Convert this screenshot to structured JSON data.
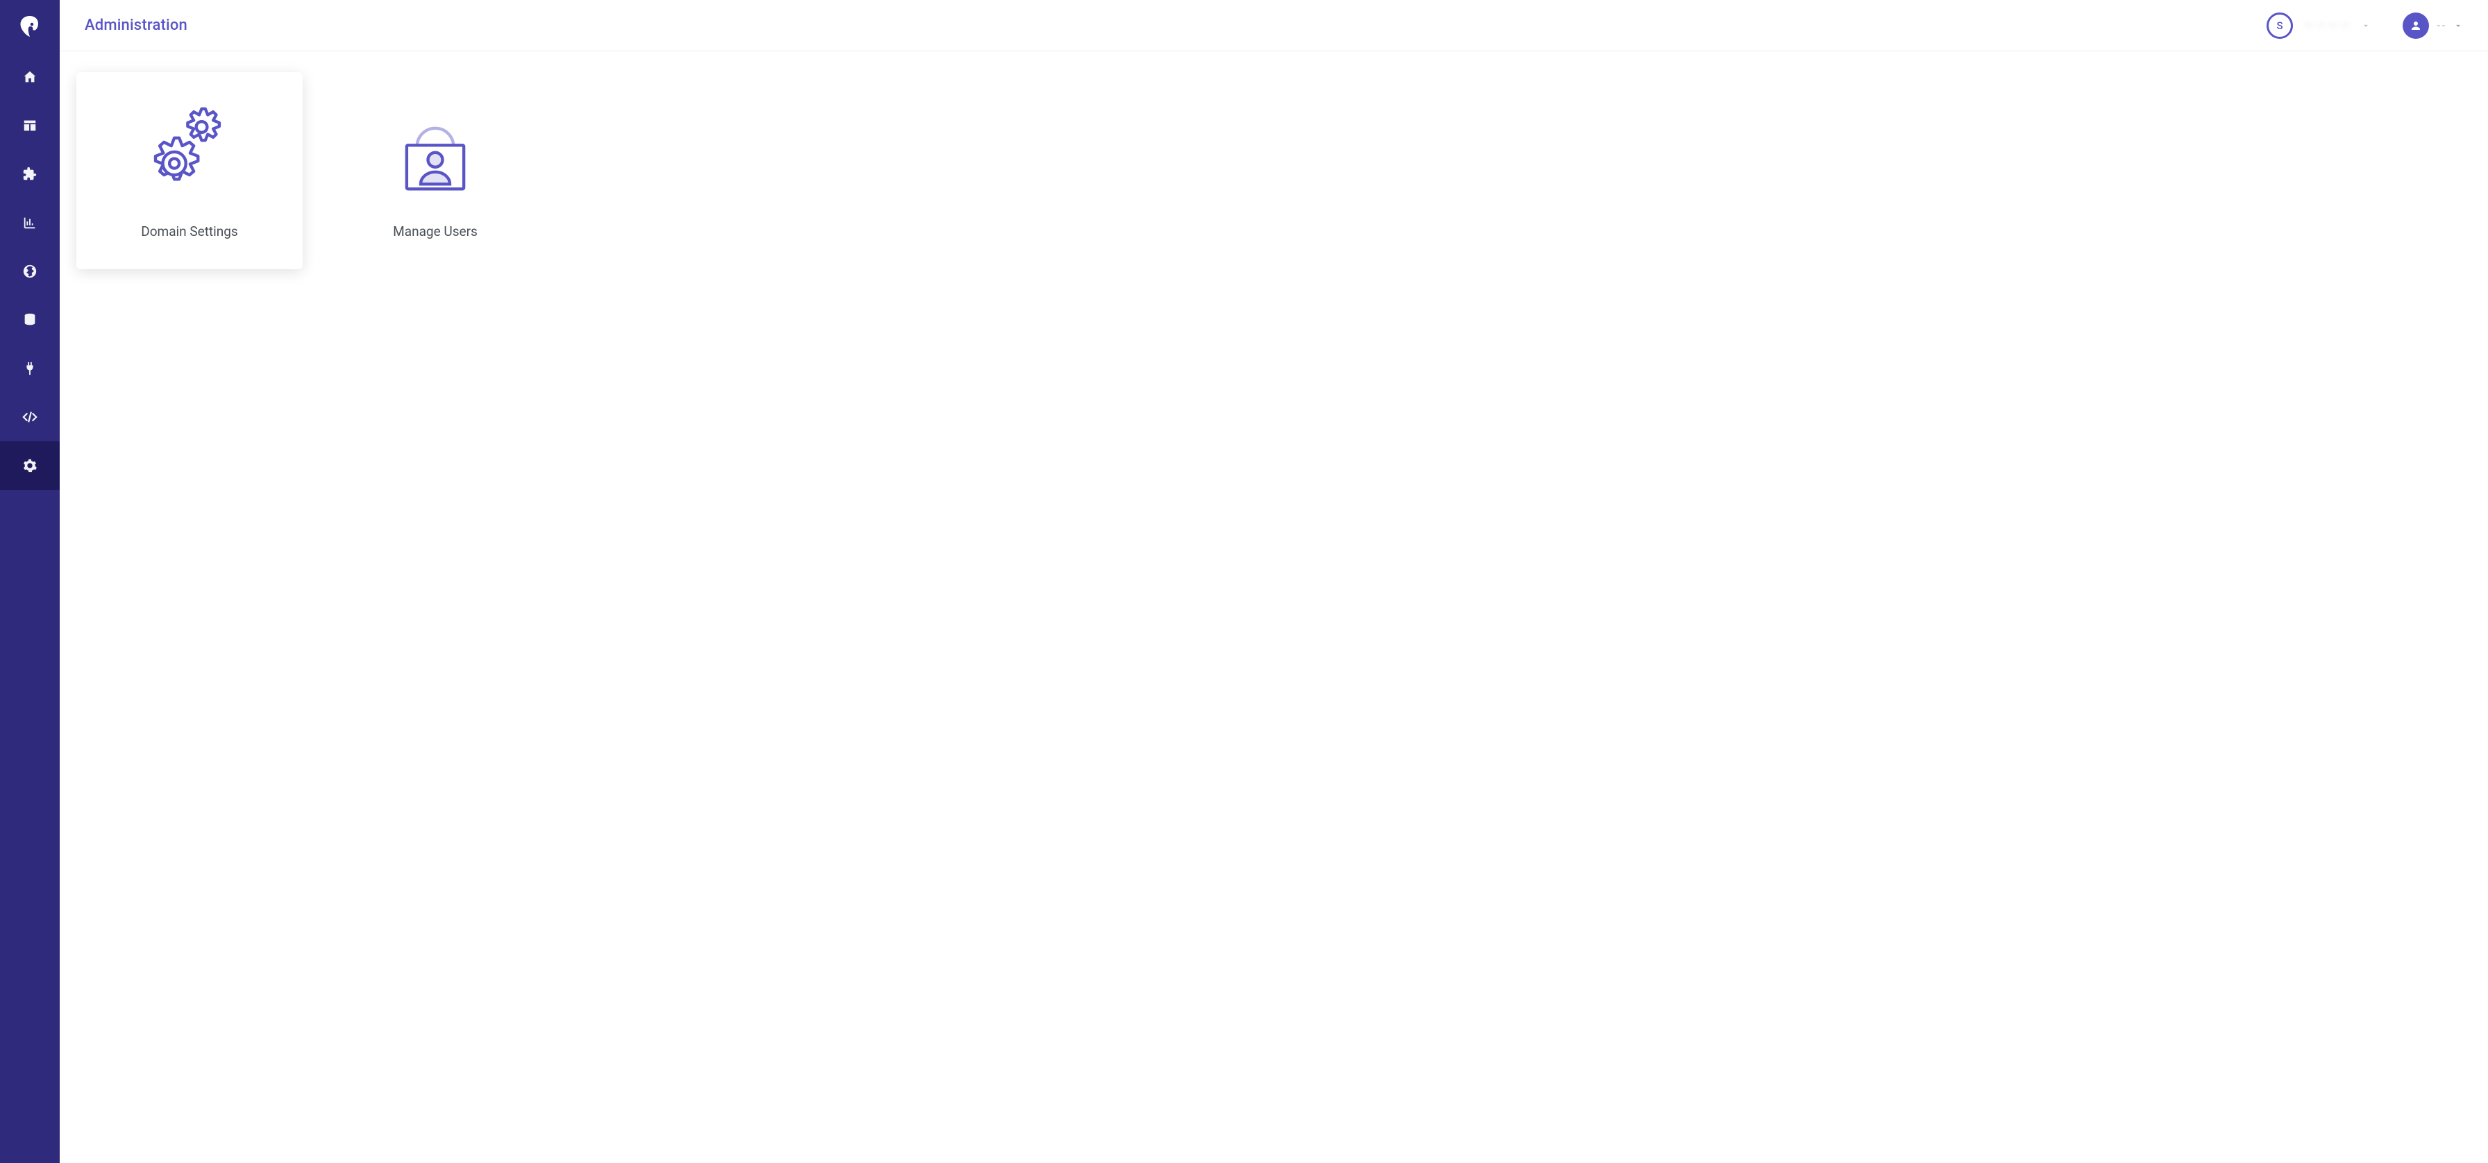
{
  "header": {
    "page_title": "Administration",
    "avatar_initial": "S",
    "org_name": "— — — —",
    "secondary_label": "- -"
  },
  "sidebar": {
    "items": [
      {
        "name": "home"
      },
      {
        "name": "layout"
      },
      {
        "name": "extensions"
      },
      {
        "name": "analytics"
      },
      {
        "name": "globe"
      },
      {
        "name": "database"
      },
      {
        "name": "plug"
      },
      {
        "name": "code"
      },
      {
        "name": "settings"
      }
    ],
    "active_index": 8
  },
  "cards": [
    {
      "key": "domain-settings",
      "label": "Domain Settings",
      "elevated": true
    },
    {
      "key": "manage-users",
      "label": "Manage Users",
      "elevated": false
    }
  ]
}
